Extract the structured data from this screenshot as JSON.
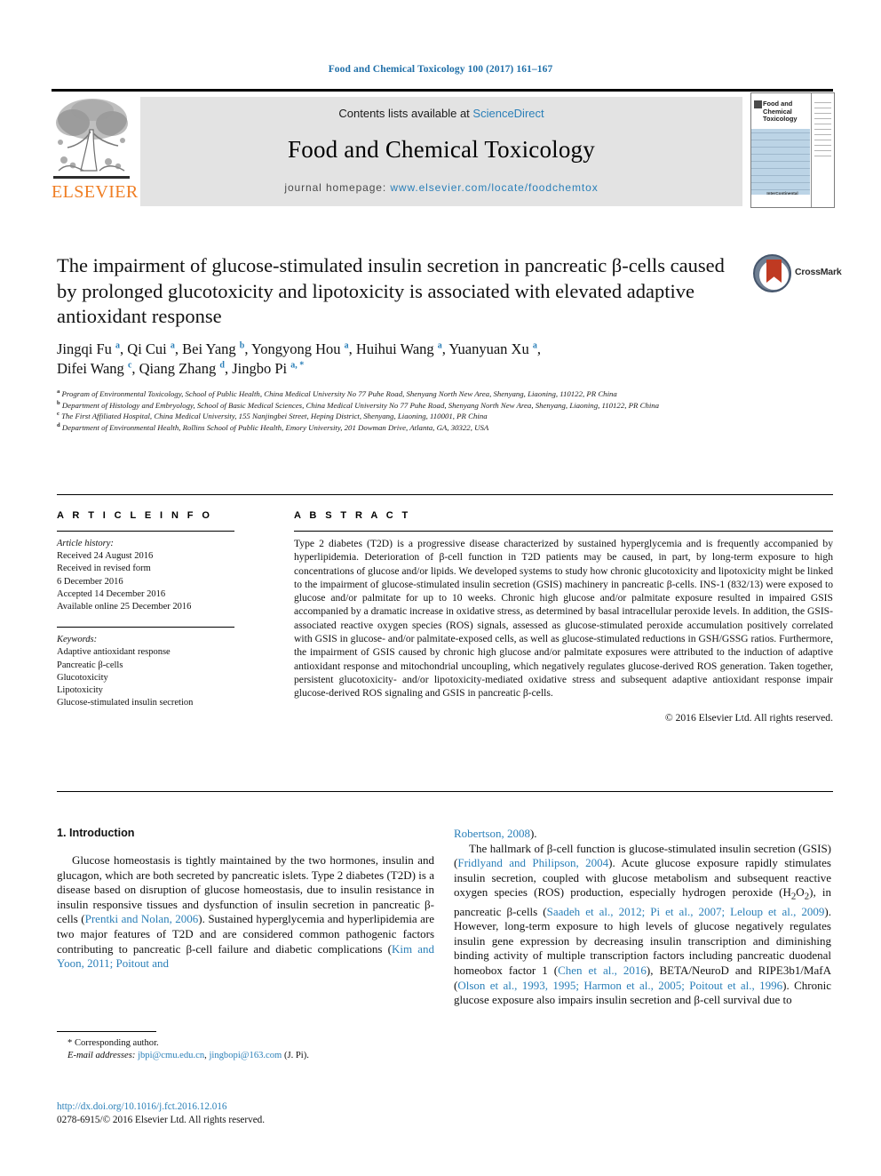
{
  "running_head": "Food and Chemical Toxicology 100 (2017) 161–167",
  "masthead": {
    "publisher": "ELSEVIER",
    "contents_prefix": "Contents lists available at",
    "contents_link": "ScienceDirect",
    "journal_title": "Food and Chemical Toxicology",
    "homepage_prefix": "journal homepage:",
    "homepage_url": "www.elsevier.com/locate/foodchemtox",
    "cover": {
      "journal_name": "Food and Chemical Toxicology",
      "footer_text": "InterContinental"
    }
  },
  "article": {
    "title": "The impairment of glucose-stimulated insulin secretion in pancreatic β-cells caused by prolonged glucotoxicity and lipotoxicity is associated with elevated adaptive antioxidant response",
    "crossmark_label": "CrossMark",
    "authors_line1": "Jingqi Fu <sup>a</sup>, Qi Cui <sup>a</sup>, Bei Yang <sup>b</sup>, Yongyong Hou <sup>a</sup>, Huihui Wang <sup>a</sup>, Yuanyuan Xu <sup>a</sup>,",
    "authors_line2": "Difei Wang <sup>c</sup>, Qiang Zhang <sup>d</sup>, Jingbo Pi <sup>a, *</sup>",
    "affiliations": [
      "<sup>a</sup> Program of Environmental Toxicology, School of Public Health, China Medical University No 77 Puhe Road, Shenyang North New Area, Shenyang, Liaoning, 110122, PR China",
      "<sup>b</sup> Department of Histology and Embryology, School of Basic Medical Sciences, China Medical University No 77 Puhe Road, Shenyang North New Area, Shenyang, Liaoning, 110122, PR China",
      "<sup>c</sup> The First Affiliated Hospital, China Medical University, 155 Nanjingbei Street, Heping District, Shenyang, Liaoning, 110001, PR China",
      "<sup>d</sup> Department of Environmental Health, Rollins School of Public Health, Emory University, 201 Dowman Drive, Atlanta, GA, 30322, USA"
    ]
  },
  "article_info": {
    "heading": "A R T I C L E  I N F O",
    "history_label": "Article history:",
    "history": [
      "Received 24 August 2016",
      "Received in revised form",
      "6 December 2016",
      "Accepted 14 December 2016",
      "Available online 25 December 2016"
    ],
    "keywords_label": "Keywords:",
    "keywords": [
      "Adaptive antioxidant response",
      "Pancreatic β-cells",
      "Glucotoxicity",
      "Lipotoxicity",
      "Glucose-stimulated insulin secretion"
    ]
  },
  "abstract": {
    "heading": "A B S T R A C T",
    "text": "Type 2 diabetes (T2D) is a progressive disease characterized by sustained hyperglycemia and is frequently accompanied by hyperlipidemia. Deterioration of β-cell function in T2D patients may be caused, in part, by long-term exposure to high concentrations of glucose and/or lipids. We developed systems to study how chronic glucotoxicity and lipotoxicity might be linked to the impairment of glucose-stimulated insulin secretion (GSIS) machinery in pancreatic β-cells. INS-1 (832/13) were exposed to glucose and/or palmitate for up to 10 weeks. Chronic high glucose and/or palmitate exposure resulted in impaired GSIS accompanied by a dramatic increase in oxidative stress, as determined by basal intracellular peroxide levels. In addition, the GSIS-associated reactive oxygen species (ROS) signals, assessed as glucose-stimulated peroxide accumulation positively correlated with GSIS in glucose- and/or palmitate-exposed cells, as well as glucose-stimulated reductions in GSH/GSSG ratios. Furthermore, the impairment of GSIS caused by chronic high glucose and/or palmitate exposures were attributed to the induction of adaptive antioxidant response and mitochondrial uncoupling, which negatively regulates glucose-derived ROS generation. Taken together, persistent glucotoxicity- and/or lipotoxicity-mediated oxidative stress and subsequent adaptive antioxidant response impair glucose-derived ROS signaling and GSIS in pancreatic β-cells.",
    "copyright": "© 2016 Elsevier Ltd. All rights reserved."
  },
  "body": {
    "section_number_title": "1. Introduction",
    "left_paragraph_html": "Glucose homeostasis is tightly maintained by the two hormones, insulin and glucagon, which are both secreted by pancreatic islets. Type 2 diabetes (T2D) is a disease based on disruption of glucose homeostasis, due to insulin resistance in insulin responsive tissues and dysfunction of insulin secretion in pancreatic β-cells (<span class=\"ref\">Prentki and Nolan, 2006</span>). Sustained hyperglycemia and hyperlipidemia are two major features of T2D and are considered common pathogenic factors contributing to pancreatic β-cell failure and diabetic complications (<span class=\"ref\">Kim and Yoon, 2011; Poitout and</span>",
    "right_paragraph1_html": "<span class=\"ref\">Robertson, 2008</span>).",
    "right_paragraph2_html": "The hallmark of β-cell function is glucose-stimulated insulin secretion (GSIS) (<span class=\"ref\">Fridlyand and Philipson, 2004</span>). Acute glucose exposure rapidly stimulates insulin secretion, coupled with glucose metabolism and subsequent reactive oxygen species (ROS) production, especially hydrogen peroxide (H<sub>2</sub>O<sub>2</sub>), in pancreatic β-cells (<span class=\"ref\">Saadeh et al., 2012; Pi et al., 2007; Leloup et al., 2009</span>). However, long-term exposure to high levels of glucose negatively regulates insulin gene expression by decreasing insulin transcription and diminishing binding activity of multiple transcription factors including pancreatic duodenal homeobox factor 1 (<span class=\"ref\">Chen et al., 2016</span>), BETA/NeuroD and RIPE3b1/MafA (<span class=\"ref\">Olson et al., 1993, 1995; Harmon et al., 2005; Poitout et al., 1996</span>). Chronic glucose exposure also impairs insulin secretion and β-cell survival due to"
  },
  "footnote": {
    "corresponding": "* Corresponding author.",
    "email_label": "E-mail addresses:",
    "email1": "jbpi@cmu.edu.cn",
    "email_sep": ",",
    "email2": "jingbopi@163.com",
    "email_suffix": "(J. Pi)."
  },
  "footer": {
    "doi": "http://dx.doi.org/10.1016/j.fct.2016.12.016",
    "issn_line": "0278-6915/© 2016 Elsevier Ltd. All rights reserved."
  },
  "colors": {
    "link_blue": "#2a7fb8",
    "elsevier_orange": "#ef7d22",
    "panel_grey": "#e3e3e3",
    "crossmark_red": "#bf3a22"
  }
}
